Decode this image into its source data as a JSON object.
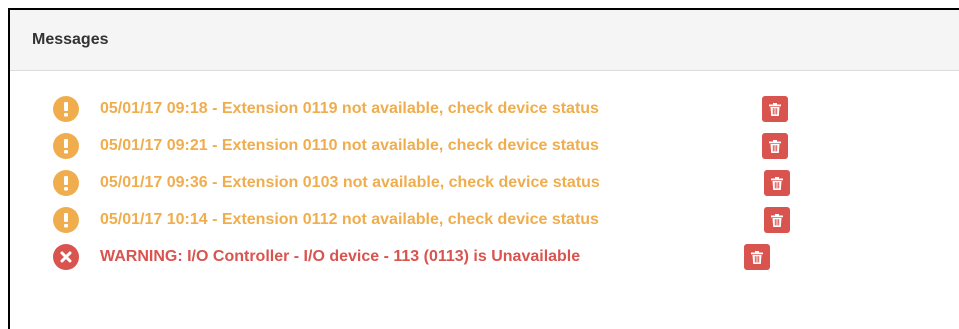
{
  "panel": {
    "title": "Messages"
  },
  "messages": [
    {
      "severity": "warning",
      "icon": "exclamation-circle-icon",
      "text": "05/01/17 09:18 - Extension 0119 not available, check device status"
    },
    {
      "severity": "warning",
      "icon": "exclamation-circle-icon",
      "text": "05/01/17 09:21 - Extension 0110 not available, check device status"
    },
    {
      "severity": "warning",
      "icon": "exclamation-circle-icon",
      "text": "05/01/17 09:36 - Extension 0103 not available, check device status"
    },
    {
      "severity": "warning",
      "icon": "exclamation-circle-icon",
      "text": "05/01/17 10:14 - Extension 0112 not available, check device status"
    },
    {
      "severity": "error",
      "icon": "times-circle-icon",
      "text": "WARNING: I/O Controller - I/O device - 113 (0113) is Unavailable"
    }
  ],
  "actions": {
    "delete_icon": "trash-icon"
  },
  "colors": {
    "warning": "#f0ad4e",
    "error": "#d9534f",
    "header_bg": "#f5f5f5",
    "title": "#333333"
  }
}
